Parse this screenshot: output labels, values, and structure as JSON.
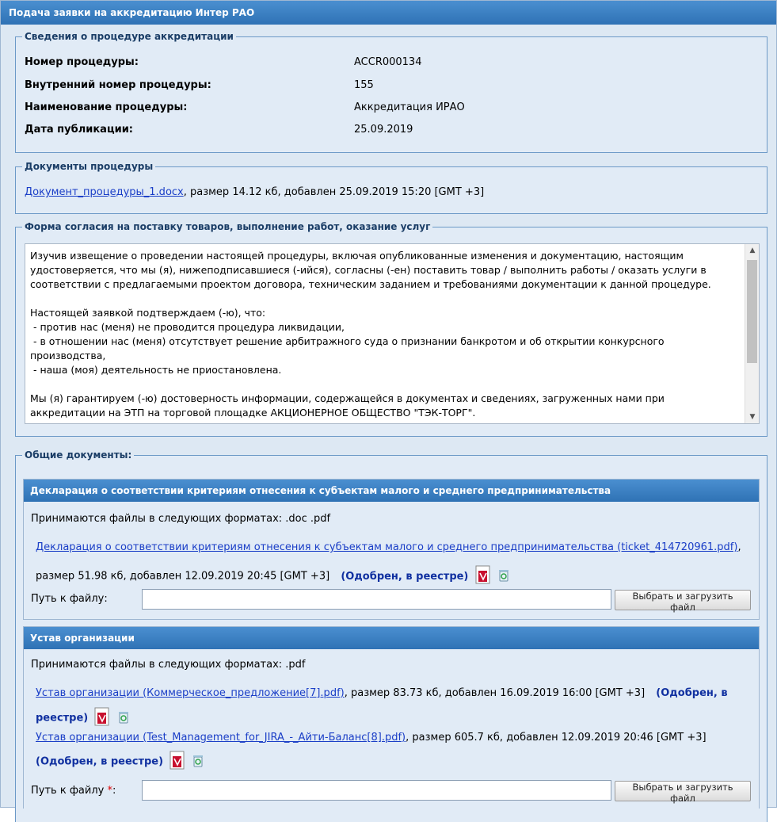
{
  "window": {
    "title": "Подача заявки на аккредитацию Интер РАО"
  },
  "procedure": {
    "legend": "Сведения о процедуре аккредитации",
    "rows": [
      {
        "label": "Номер процедуры:",
        "value": "ACCR000134"
      },
      {
        "label": "Внутренний номер процедуры:",
        "value": "155"
      },
      {
        "label": "Наименование процедуры:",
        "value": "Аккредитация ИРАО"
      },
      {
        "label": "Дата публикации:",
        "value": "25.09.2019"
      }
    ]
  },
  "proc_docs": {
    "legend": "Документы процедуры",
    "doc_link": "Документ_процедуры_1.docx",
    "doc_meta": ", размер 14.12 кб, добавлен 25.09.2019 15:20 [GMT +3]"
  },
  "consent": {
    "legend": "Форма согласия на поставку товаров, выполнение работ, оказание услуг",
    "p1": "Изучив извещение о проведении настоящей процедуры, включая опубликованные изменения и документацию, настоящим удостоверяется, что мы (я), нижеподписавшиеся (-ийся), согласны (-ен) поставить товар / выполнить работы / оказать услуги в соответствии с предлагаемыми проектом договора, техническим заданием и требованиями документации к данной процедуре.",
    "p2_lines": [
      "Настоящей заявкой подтверждаем (-ю), что:",
      " - против нас (меня) не проводится процедура ликвидации,",
      " - в отношении нас (меня) отсутствует решение арбитражного суда о признании банкротом и об открытии конкурсного производства,",
      " - наша (моя) деятельность не приостановлена."
    ],
    "p3": "Мы (я) гарантируем (-ю) достоверность информации, содержащейся в документах и сведениях, загруженных нами при аккредитации на ЭТП на  торговой площадке АКЦИОНЕРНОЕ ОБЩЕСТВО \"ТЭК-ТОРГ\"."
  },
  "common_docs": {
    "legend": "Общие документы:",
    "declaration": {
      "header": "Декларация о соответствии критериям отнесения к субъектам малого и среднего предпринимательства",
      "formats": "Принимаются файлы в следующих форматах: .doc .pdf",
      "file_link": "Декларация о соответствии критериям отнесения к субъектам малого и среднего предпринимательства (ticket_414720961.pdf)",
      "file_tail": ",",
      "file_meta": "размер 51.98 кб, добавлен 12.09.2019 20:45 [GMT +3]",
      "status": "(Одобрен, в реестре)",
      "path_label": "Путь к файлу:",
      "path_value": "",
      "upload_btn": "Выбрать и загрузить файл"
    },
    "charter": {
      "header": "Устав организации",
      "formats": "Принимаются файлы в следующих форматах: .pdf",
      "file1_link": "Устав организации (Коммерческое_предложение[7].pdf)",
      "file1_meta": ", размер 83.73 кб, добавлен 16.09.2019 16:00 [GMT +3]",
      "file1_status_a": "(Одобрен, в",
      "file1_status_b": "реестре)",
      "file2_link": "Устав организации (Test_Management_for_JIRA_-_Айти-Баланс[8].pdf)",
      "file2_meta": ", размер 605.7 кб, добавлен 12.09.2019 20:46 [GMT +3]",
      "file2_status": "(Одобрен, в реестре)",
      "path_label": "Путь к файлу",
      "required_mark": "*",
      "path_colon": ":",
      "path_value": "",
      "upload_btn": "Выбрать и загрузить файл"
    }
  },
  "icons": {
    "pdf": "pdf-file-icon",
    "delete": "recycle-bin-icon"
  },
  "colors": {
    "header_blue": "#2f72b5",
    "link": "#1a3ec7",
    "approved": "#1030a0"
  }
}
